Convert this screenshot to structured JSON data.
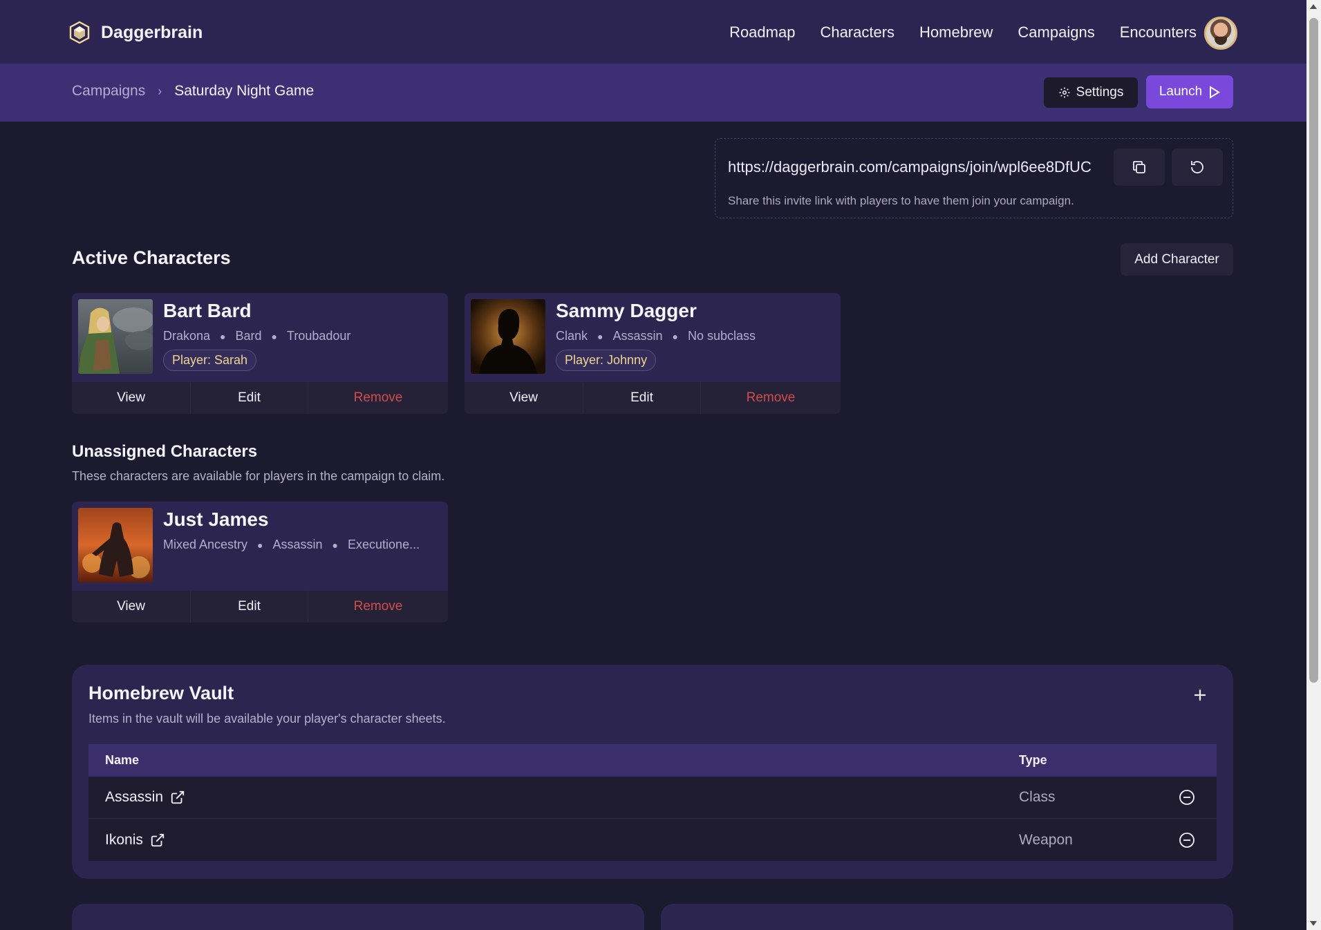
{
  "app": {
    "brand": "Daggerbrain",
    "nav": [
      "Roadmap",
      "Characters",
      "Homebrew",
      "Campaigns",
      "Encounters"
    ]
  },
  "breadcrumb": {
    "parent": "Campaigns",
    "separator": "›",
    "current": "Saturday Night Game"
  },
  "toolbar": {
    "settings_label": "Settings",
    "launch_label": "Launch"
  },
  "invite": {
    "url": "https://daggerbrain.com/campaigns/join/wpl6ee8DfUC",
    "note": "Share this invite link with players to have them join your campaign."
  },
  "active": {
    "title": "Active Characters",
    "add_label": "Add Character",
    "characters": [
      {
        "name": "Bart Bard",
        "ancestry": "Drakona",
        "class": "Bard",
        "subclass": "Troubadour",
        "player": "Player: Sarah"
      },
      {
        "name": "Sammy Dagger",
        "ancestry": "Clank",
        "class": "Assassin",
        "subclass": "No subclass",
        "player": "Player: Johnny"
      }
    ]
  },
  "unassigned": {
    "title": "Unassigned Characters",
    "desc": "These characters are available for players in the campaign to claim.",
    "characters": [
      {
        "name": "Just James",
        "ancestry": "Mixed Ancestry",
        "class": "Assassin",
        "subclass": "Executione..."
      }
    ]
  },
  "actions": {
    "view": "View",
    "edit": "Edit",
    "remove": "Remove"
  },
  "vault": {
    "title": "Homebrew Vault",
    "desc": "Items in the vault will be available your player's character sheets.",
    "columns": {
      "name": "Name",
      "type": "Type"
    },
    "rows": [
      {
        "name": "Assassin",
        "type": "Class"
      },
      {
        "name": "Ikonis",
        "type": "Weapon"
      }
    ]
  },
  "colors": {
    "topbar": "#2c2551",
    "subbar": "#3d2f74",
    "background": "#1c1a2e",
    "accent": "#7a49dc",
    "remove": "#d24c4c",
    "pill_text": "#f1d58f"
  }
}
